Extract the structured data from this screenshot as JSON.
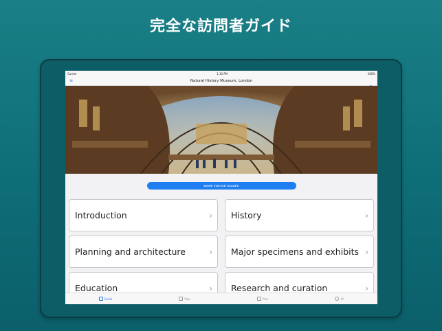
{
  "headline": "完全な訪問者ガイド",
  "status": {
    "carrier": "Carrier",
    "time": "1:10 PM",
    "battery": "100%"
  },
  "nav": {
    "title": "Natural History Museum, London"
  },
  "cta": {
    "label": "MORE VISITOR GUIDES"
  },
  "cards": [
    {
      "label": "Introduction"
    },
    {
      "label": "History"
    },
    {
      "label": "Planning and architecture"
    },
    {
      "label": "Major specimens and exhibits"
    },
    {
      "label": "Education"
    },
    {
      "label": "Research and curation"
    }
  ],
  "tabs": [
    {
      "label": "Guide",
      "icon": "book-icon"
    },
    {
      "label": "Map",
      "icon": "map-icon"
    },
    {
      "label": "Plan",
      "icon": "plan-icon"
    },
    {
      "label": "All",
      "icon": "gear-icon"
    }
  ],
  "colors": {
    "accent": "#1e7ef2",
    "background": "#0e6e78"
  }
}
